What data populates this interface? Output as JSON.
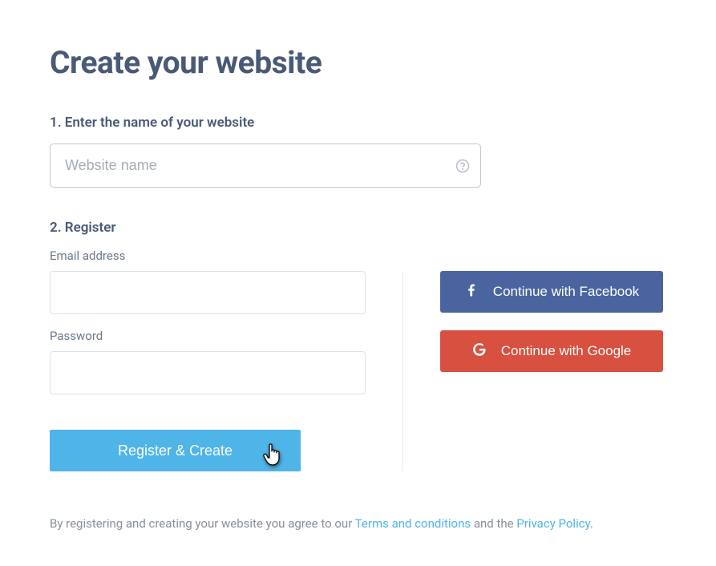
{
  "title": "Create your website",
  "step1": {
    "label": "1. Enter the name of your website",
    "placeholder": "Website name"
  },
  "step2": {
    "label": "2. Register",
    "emailLabel": "Email address",
    "passwordLabel": "Password",
    "registerButton": "Register & Create"
  },
  "social": {
    "facebook": "Continue with Facebook",
    "google": "Continue with Google"
  },
  "footer": {
    "prefix": "By registering and creating your website you agree to our ",
    "terms": "Terms and conditions",
    "middle": " and the ",
    "privacy": "Privacy Policy",
    "suffix": "."
  }
}
